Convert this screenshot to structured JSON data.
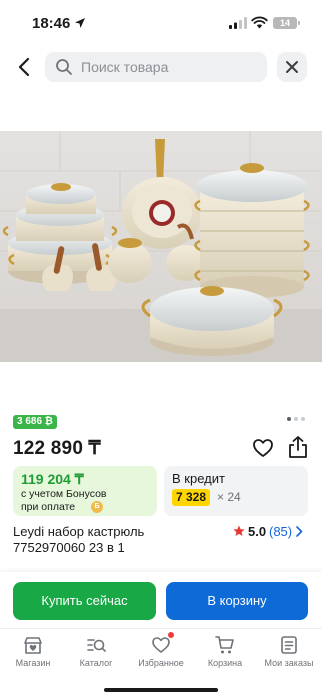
{
  "status_bar": {
    "time": "18:46",
    "battery": "14"
  },
  "search": {
    "placeholder": "Поиск товара"
  },
  "product": {
    "bonus_badge": "3 686 ₿",
    "price": "122 890 ₸",
    "title_line1": "Leydi набор кастрюль",
    "title_line2": "7752970060 23 в 1",
    "rating": "5.0",
    "reviews": "(85)",
    "image_count": 3,
    "active_image": 1
  },
  "bonus_offer": {
    "price": "119 204 ₸",
    "note_line1": "с учетом Бонусов",
    "note_line2": "при оплате",
    "coin_label": "Б"
  },
  "credit_offer": {
    "title": "В кредит",
    "monthly": "7 328",
    "term": "× 24"
  },
  "actions": {
    "buy_now": "Купить сейчас",
    "add_to_cart": "В корзину"
  },
  "bottom_nav": {
    "items": [
      {
        "label": "Магазин",
        "icon": "shop-icon"
      },
      {
        "label": "Каталог",
        "icon": "catalog-search-icon"
      },
      {
        "label": "Избранное",
        "icon": "heart-icon"
      },
      {
        "label": "Корзина",
        "icon": "cart-icon"
      },
      {
        "label": "Мои заказы",
        "icon": "orders-icon"
      }
    ]
  },
  "colors": {
    "green_accent": "#18a845",
    "blue_accent": "#0e6ad7",
    "bonus_badge": "#3bb44a",
    "bonus_card_bg": "#e6f7dc",
    "credit_highlight": "#ffd500",
    "star": "#e53935",
    "link_blue": "#1565d8"
  }
}
